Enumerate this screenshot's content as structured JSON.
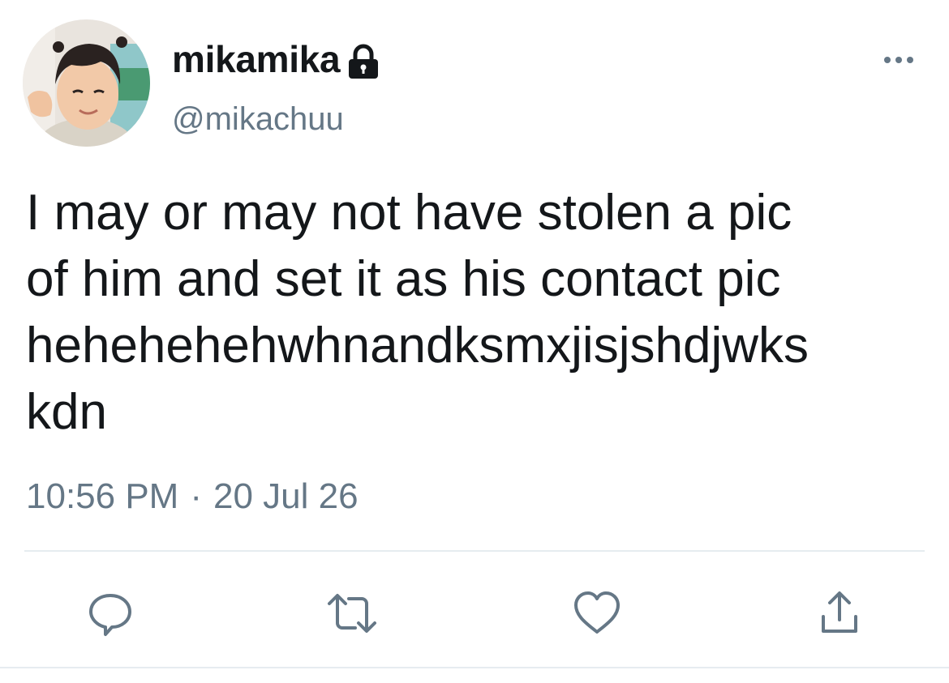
{
  "author": {
    "display_name": "mikamika",
    "handle": "@mikachuu",
    "protected_icon": "lock-icon",
    "avatar": "child-photo-avatar"
  },
  "tweet": {
    "lines": [
      "I may or may not have stolen a pic",
      "of him and set it as his contact pic",
      "hehehehehwhnandksmxjisjshdjwks",
      "kdn"
    ],
    "time": "10:56 PM",
    "separator": "·",
    "date": "20 Jul 26"
  },
  "actions": {
    "more_icon": "more-horizontal-icon",
    "reply_icon": "reply-icon",
    "retweet_icon": "retweet-icon",
    "like_icon": "heart-icon",
    "share_icon": "share-icon"
  },
  "colors": {
    "text_primary": "#14171a",
    "text_secondary": "#657786",
    "icon": "#657786",
    "divider": "#e6ecf0"
  }
}
